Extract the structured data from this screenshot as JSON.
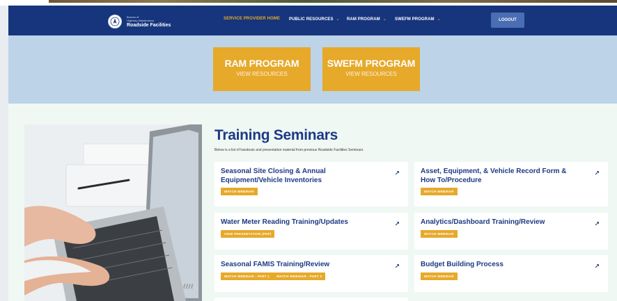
{
  "brand": {
    "small_line1": "Bureau of",
    "small_line2": "Highway Maintenance",
    "name": "Roadside Facilities"
  },
  "nav": {
    "home": "SERVICE PROVIDER HOME",
    "public_resources": "PUBLIC RESOURCES",
    "ram_program": "RAM PROGRAM",
    "swefm_program": "SWEFM PROGRAM",
    "chevron": "⌄",
    "logout": "LOGOUT"
  },
  "programs": [
    {
      "title": "RAM PROGRAM",
      "subtitle": "VIEW RESOURCES"
    },
    {
      "title": "SWEFM PROGRAM",
      "subtitle": "VIEW RESOURCES"
    }
  ],
  "training": {
    "title": "Training Seminars",
    "subtitle": "Below is a list of handouts and presentation material from previous Roadside Facilities Seminars.",
    "arrow": "↗",
    "cards": [
      {
        "title": "Seasonal Site Closing & Annual Equipment/Vehicle Inventories",
        "badges": [
          "WATCH WEBINAR"
        ]
      },
      {
        "title": "Asset, Equipment, & Vehicle Record Form & How To/Procedure",
        "badges": [
          "WATCH WEBINAR"
        ]
      },
      {
        "title": "Water Meter Reading Training/Updates",
        "badges": [
          "VIEW PRESENTATION (PDF)"
        ]
      },
      {
        "title": "Analytics/Dashboard Training/Review",
        "badges": [
          "WATCH WEBINAR"
        ]
      },
      {
        "title": "Seasonal FAMIS Training/Review",
        "badges": [
          "WATCH WEBINAR - PART 1",
          "WATCH WEBINAR - PART 2"
        ]
      },
      {
        "title": "Budget Building Process",
        "badges": [
          "WATCH WEBINAR"
        ]
      }
    ]
  },
  "colors": {
    "header_bg": "#16357c",
    "accent_gold": "#e6a92a",
    "hero_bg": "#bdd3e8",
    "title_blue": "#1c3a84",
    "logout_bg": "#4a6db3"
  }
}
